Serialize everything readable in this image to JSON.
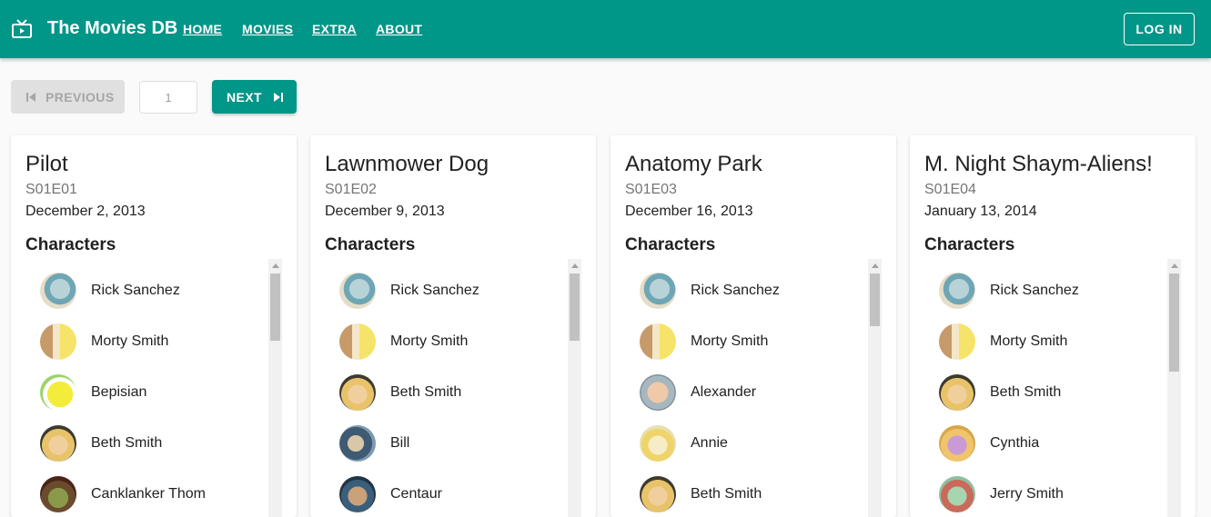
{
  "app": {
    "title": "The Movies DB",
    "brand_icon": "tv-icon",
    "accent_color": "#009688"
  },
  "nav": {
    "items": [
      "HOME",
      "MOVIES",
      "EXTRA",
      "ABOUT"
    ],
    "login_label": "LOG IN"
  },
  "pager": {
    "previous_label": "PREVIOUS",
    "previous_icon": "skip-previous-icon",
    "page_value": "1",
    "next_label": "NEXT",
    "next_icon": "skip-next-icon"
  },
  "episodes": [
    {
      "title": "Pilot",
      "code": "S01E01",
      "date": "December 2, 2013",
      "characters_heading": "Characters",
      "characters": [
        "Rick Sanchez",
        "Morty Smith",
        "Bepisian",
        "Beth Smith",
        "Canklanker Thom"
      ]
    },
    {
      "title": "Lawnmower Dog",
      "code": "S01E02",
      "date": "December 9, 2013",
      "characters_heading": "Characters",
      "characters": [
        "Rick Sanchez",
        "Morty Smith",
        "Beth Smith",
        "Bill",
        "Centaur"
      ]
    },
    {
      "title": "Anatomy Park",
      "code": "S01E03",
      "date": "December 16, 2013",
      "characters_heading": "Characters",
      "characters": [
        "Rick Sanchez",
        "Morty Smith",
        "Alexander",
        "Annie",
        "Beth Smith"
      ]
    },
    {
      "title": "M. Night Shaym-Aliens!",
      "code": "S01E04",
      "date": "January 13, 2014",
      "characters_heading": "Characters",
      "characters": [
        "Rick Sanchez",
        "Morty Smith",
        "Beth Smith",
        "Cynthia",
        "Jerry Smith"
      ]
    }
  ]
}
